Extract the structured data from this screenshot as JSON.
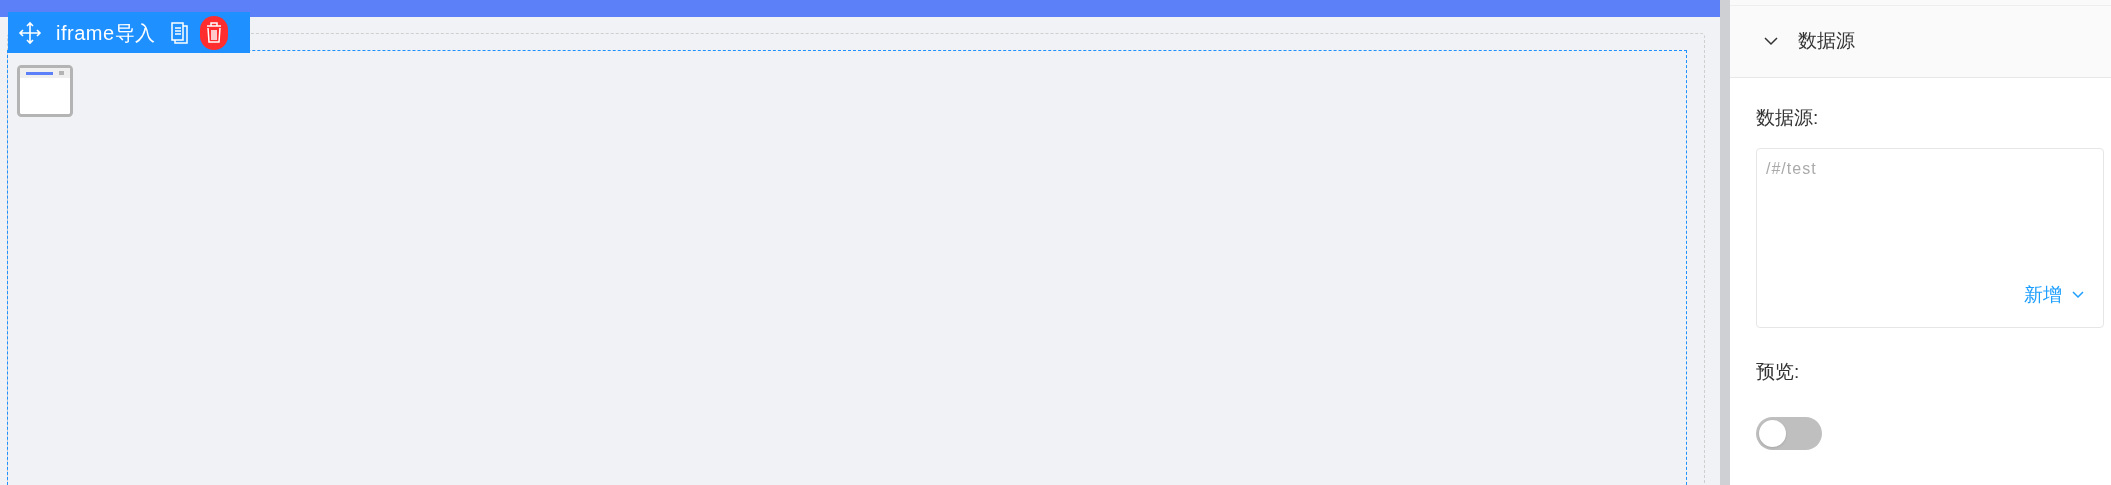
{
  "component_toolbar": {
    "title": "iframe导入"
  },
  "panel": {
    "section": {
      "title": "数据源",
      "expanded": true
    },
    "fields": [
      {
        "kind": "textarea",
        "label": "数据源:",
        "placeholder": "/#/test",
        "action": "新增"
      },
      {
        "kind": "switch",
        "label": "预览:",
        "checked": false
      }
    ]
  }
}
